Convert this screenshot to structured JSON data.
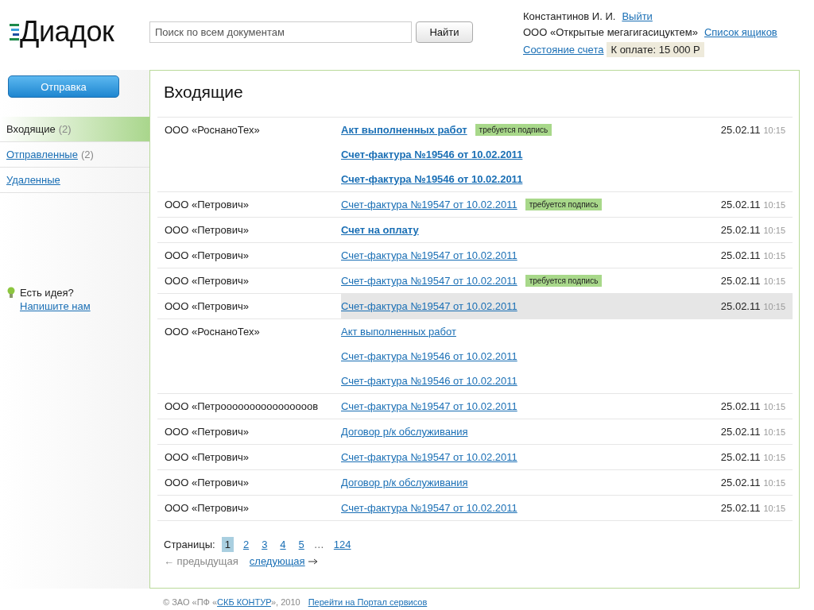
{
  "header": {
    "logo": "Диадок",
    "search": {
      "placeholder": "Поиск по всем документам"
    },
    "search_button": "Найти",
    "user": "Константинов И. И.",
    "logout": "Выйти",
    "organization": "ООО «Открытые мегагигасицуктем»",
    "mailboxes_link": "Список ящиков",
    "account_link": "Состояние счета",
    "balance": "К оплате: 15 000 Р"
  },
  "sidebar": {
    "send_button": "Отправка",
    "items": [
      {
        "label": "Входящие",
        "count": "(2)",
        "selected": true
      },
      {
        "label": "Отправленные",
        "count": "(2)",
        "selected": false
      },
      {
        "label": "Удаленные",
        "selected": false
      }
    ],
    "idea": {
      "question": "Есть идея?",
      "link": "Напишите нам"
    }
  },
  "inbox": {
    "title": "Входящие",
    "rows": [
      {
        "sender": "ООО «РоснаноТех»",
        "date": "25.02.11",
        "time": "10:15",
        "hovered": false,
        "documents": [
          {
            "title": "Акт выполненных работ",
            "unread": true,
            "tag": "требуется подпись"
          },
          {
            "title": "Счет-фактура №19546 от 10.02.2011",
            "unread": true
          },
          {
            "title": "Счет-фактура №19546 от 10.02.2011",
            "unread": true
          }
        ]
      },
      {
        "sender": "ООО «Петрович»",
        "date": "25.02.11",
        "time": "10:15",
        "hovered": false,
        "documents": [
          {
            "title": "Счет-фактура №19547 от 10.02.2011",
            "unread": false,
            "tag": "требуется подпись"
          }
        ]
      },
      {
        "sender": "ООО «Петрович»",
        "date": "25.02.11",
        "time": "10:15",
        "hovered": false,
        "documents": [
          {
            "title": "Счет на оплату",
            "unread": true
          }
        ]
      },
      {
        "sender": "ООО «Петрович»",
        "date": "25.02.11",
        "time": "10:15",
        "hovered": false,
        "documents": [
          {
            "title": "Счет-фактура №19547 от 10.02.2011",
            "unread": false
          }
        ]
      },
      {
        "sender": "ООО «Петрович»",
        "date": "25.02.11",
        "time": "10:15",
        "hovered": false,
        "documents": [
          {
            "title": "Счет-фактура №19547 от 10.02.2011",
            "unread": false,
            "tag": "требуется подпись"
          }
        ]
      },
      {
        "sender": "ООО «Петрович»",
        "date": "25.02.11",
        "time": "10:15",
        "hovered": true,
        "documents": [
          {
            "title": "Счет-фактура №19547 от 10.02.2011",
            "unread": false
          }
        ]
      },
      {
        "sender": "ООО «РоснаноТех»",
        "hovered": false,
        "documents": [
          {
            "title": "Акт выполненных работ",
            "unread": false
          },
          {
            "title": "Счет-фактура №19546 от 10.02.2011",
            "unread": false
          },
          {
            "title": "Счет-фактура №19546 от 10.02.2011",
            "unread": false
          }
        ]
      },
      {
        "sender": "ООО «Петроооооооооооооооов",
        "date": "25.02.11",
        "time": "10:15",
        "hovered": false,
        "documents": [
          {
            "title": "Счет-фактура №19547 от 10.02.2011",
            "unread": false
          }
        ]
      },
      {
        "sender": "ООО «Петрович»",
        "date": "25.02.11",
        "time": "10:15",
        "hovered": false,
        "documents": [
          {
            "title": "Договор р/к обслуживания",
            "unread": false
          }
        ]
      },
      {
        "sender": "ООО «Петрович»",
        "date": "25.02.11",
        "time": "10:15",
        "hovered": false,
        "documents": [
          {
            "title": "Счет-фактура №19547 от 10.02.2011",
            "unread": false
          }
        ]
      },
      {
        "sender": "ООО «Петрович»",
        "date": "25.02.11",
        "time": "10:15",
        "hovered": false,
        "documents": [
          {
            "title": "Договор р/к обслуживания",
            "unread": false
          }
        ]
      },
      {
        "sender": "ООО «Петрович»",
        "date": "25.02.11",
        "time": "10:15",
        "hovered": false,
        "documents": [
          {
            "title": "Счет-фактура №19547 от 10.02.2011",
            "unread": false
          }
        ]
      }
    ],
    "pagination": {
      "label": "Страницы:",
      "pages": [
        {
          "label": "1",
          "selected": true
        },
        {
          "label": "2",
          "selected": false
        },
        {
          "label": "3",
          "selected": false
        },
        {
          "label": "4",
          "selected": false
        },
        {
          "label": "5",
          "selected": false
        },
        {
          "label": "…",
          "kind": "gap"
        },
        {
          "label": "124",
          "selected": false
        }
      ],
      "previous": "← предыдущая",
      "next": "следующая"
    }
  },
  "footer": {
    "copyright_before": "© ЗАО «ПФ «",
    "company_link": "СКБ КОНТУР",
    "copyright_after": "», 2010",
    "portal_link": "Перейти на Портал сервисов"
  }
}
